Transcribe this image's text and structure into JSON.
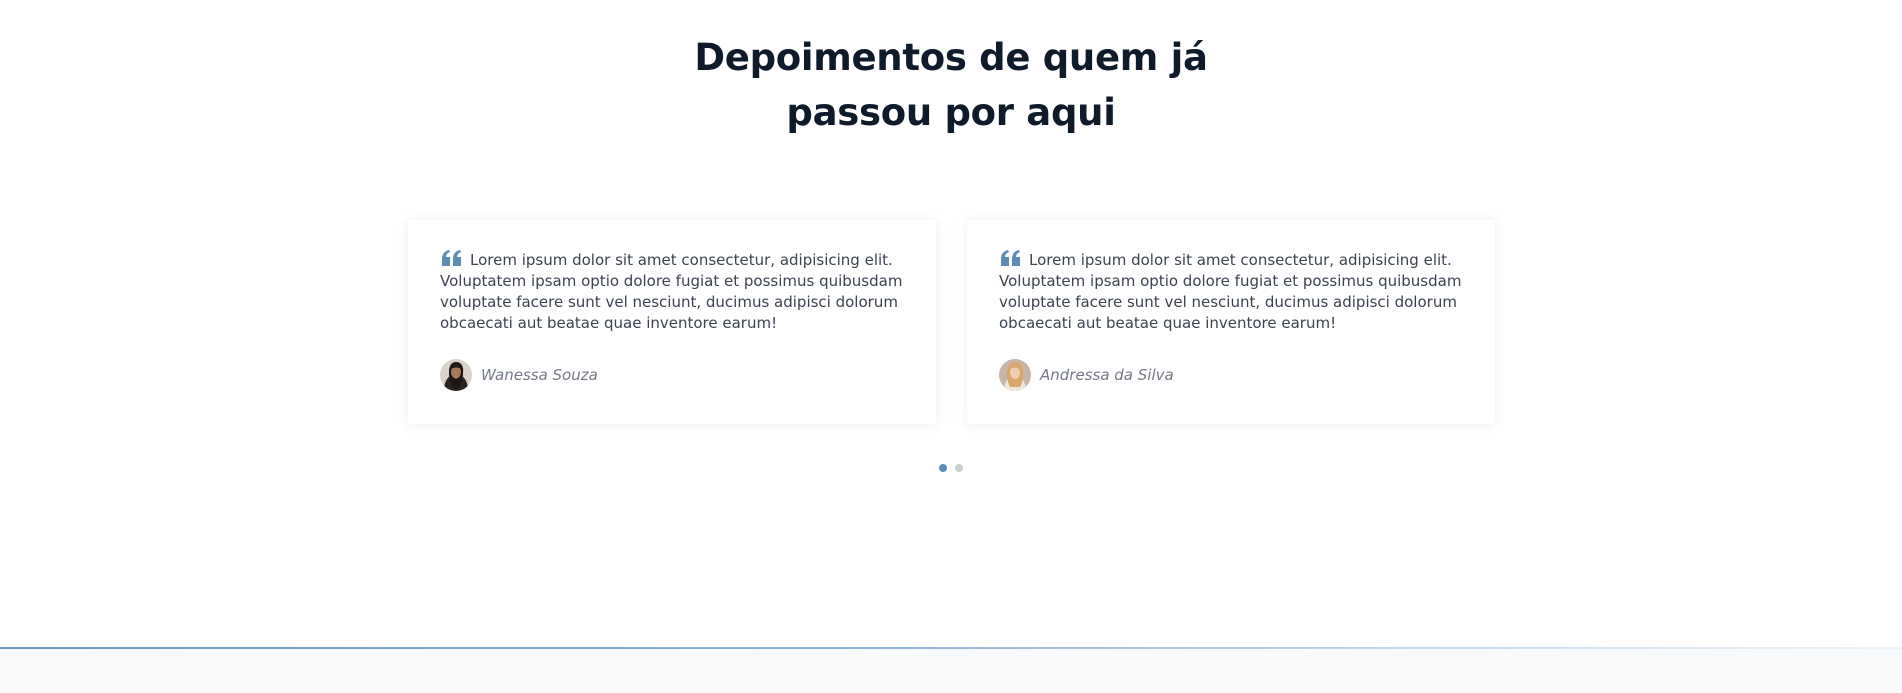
{
  "section": {
    "title_line1": "Depoimentos de quem já",
    "title_line2": "passou por aqui"
  },
  "testimonials": [
    {
      "text": "Lorem ipsum dolor sit amet consectetur, adipisicing elit. Voluptatem ipsam optio dolore fugiat et possimus quibusdam voluptate facere sunt vel nesciunt, ducimus adipisci dolorum obcaecati aut beatae quae inventore earum!",
      "author": "Wanessa Souza"
    },
    {
      "text": "Lorem ipsum dolor sit amet consectetur, adipisicing elit. Voluptatem ipsam optio dolore fugiat et possimus quibusdam voluptate facere sunt vel nesciunt, ducimus adipisci dolorum obcaecati aut beatae quae inventore earum!",
      "author": "Andressa da Silva"
    }
  ],
  "pager": {
    "total": 2,
    "active_index": 0
  },
  "colors": {
    "accent": "#5b8db8",
    "heading": "#0f1b2b",
    "body_text": "#3b4250",
    "author_text": "#737a85",
    "dot_inactive": "#c9ced4"
  },
  "icons": {
    "quote": "quote-icon"
  }
}
